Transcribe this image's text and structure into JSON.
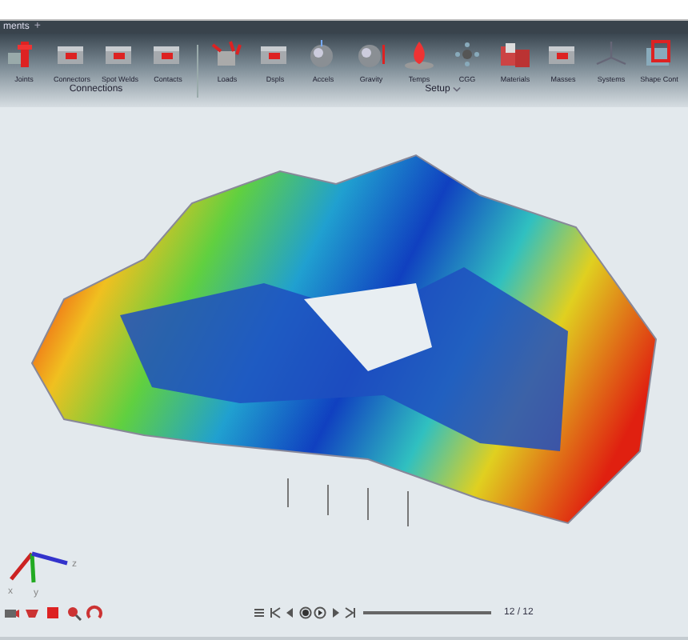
{
  "tab": {
    "label": "ments",
    "add": "+"
  },
  "groups": [
    {
      "label": "Connections",
      "dropdown": false,
      "items": [
        "Joints",
        "Connectors",
        "Spot Welds",
        "Contacts"
      ]
    },
    {
      "label": "Setup",
      "dropdown": true,
      "items": [
        "Loads",
        "Dspls",
        "Accels",
        "Gravity",
        "Temps",
        "CGG",
        "Materials",
        "Masses",
        "Systems",
        "Shape Cont"
      ]
    }
  ],
  "triad": {
    "labels": [
      "x",
      "y",
      "z"
    ]
  },
  "player": {
    "level": 1,
    "frame": "12 / 12"
  }
}
